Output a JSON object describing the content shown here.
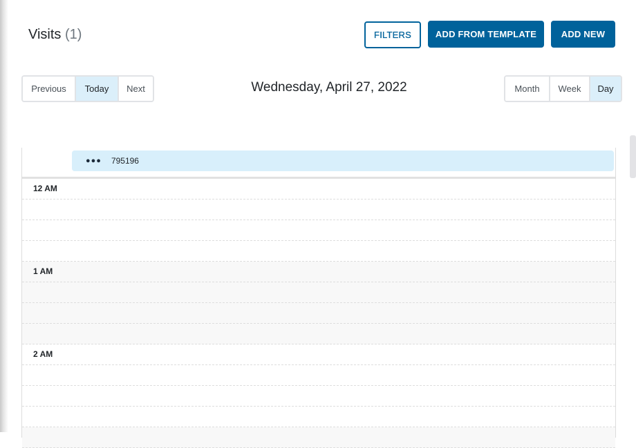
{
  "header": {
    "title": "Visits",
    "count": "(1)"
  },
  "toolbar": {
    "filters_label": "FILTERS",
    "add_from_template_label": "ADD FROM TEMPLATE",
    "add_new_label": "ADD NEW"
  },
  "navigation": {
    "previous_label": "Previous",
    "today_label": "Today",
    "next_label": "Next",
    "active": "Today"
  },
  "date_title": "Wednesday, April 27, 2022",
  "views": {
    "month_label": "Month",
    "week_label": "Week",
    "day_label": "Day",
    "active": "Day"
  },
  "all_day_events": [
    {
      "menu_icon": "more-horizontal-icon",
      "label": "795196"
    }
  ],
  "hours": [
    {
      "label": "12 AM"
    },
    {
      "label": "1 AM"
    },
    {
      "label": "2 AM"
    }
  ],
  "colors": {
    "primary": "#00629b",
    "active_segment": "#dbeffa",
    "event_chip": "#d8effb"
  }
}
